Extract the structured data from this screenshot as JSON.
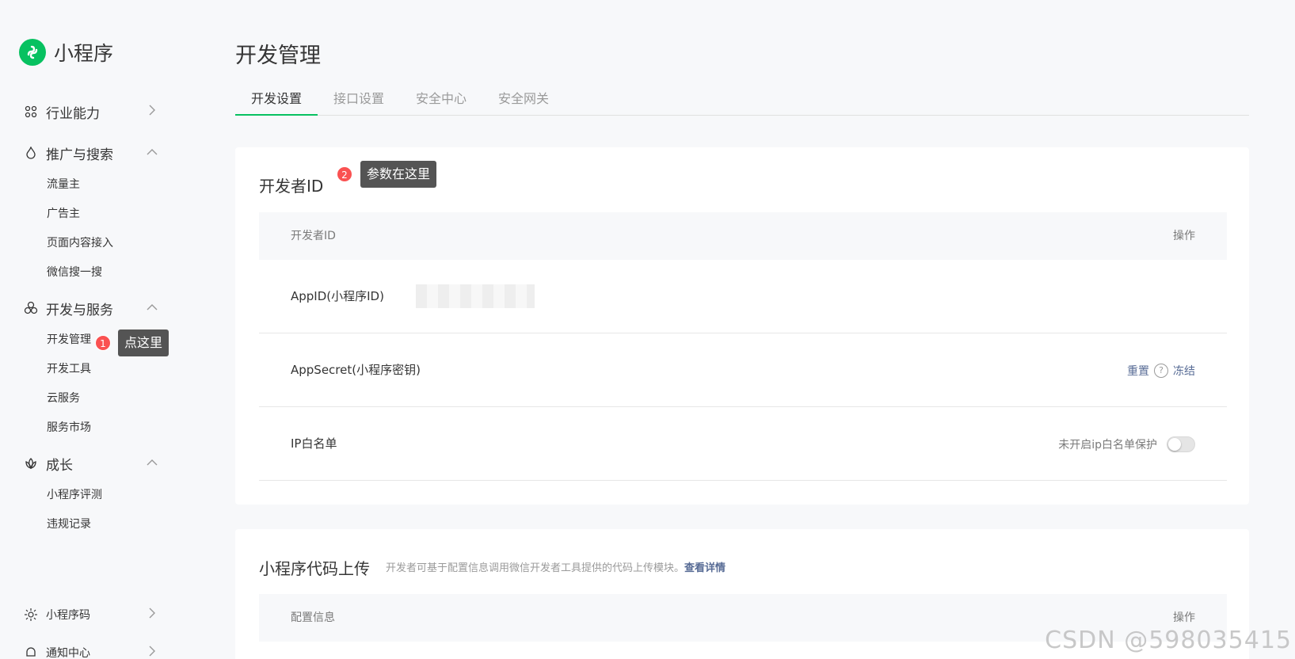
{
  "brand": {
    "title": "小程序",
    "logo_color": "#07c160"
  },
  "sidebar": {
    "groups": [
      {
        "label": "行业能力",
        "icon": "cluster-icon",
        "arrow": "›"
      },
      {
        "label": "推广与搜索",
        "icon": "flame-icon",
        "arrow": "ˆ",
        "items": [
          "流量主",
          "广告主",
          "页面内容接入",
          "微信搜一搜"
        ]
      },
      {
        "label": "开发与服务",
        "icon": "circles-icon",
        "arrow": "ˆ",
        "items": [
          "开发管理",
          "开发工具",
          "云服务",
          "服务市场"
        ]
      },
      {
        "label": "成长",
        "icon": "lotus-icon",
        "arrow": "ˆ",
        "items": [
          "小程序评测",
          "违规记录"
        ]
      },
      {
        "label": "小程序码",
        "icon": "sun-icon",
        "arrow": "›"
      },
      {
        "label": "通知中心",
        "icon": "bell-icon",
        "arrow": "›"
      }
    ]
  },
  "annotations": {
    "one": {
      "badge": "1",
      "text": "点这里"
    },
    "two": {
      "badge": "2",
      "text": "参数在这里"
    }
  },
  "main": {
    "title": "开发管理",
    "tabs": [
      "开发设置",
      "接口设置",
      "安全中心",
      "安全网关"
    ],
    "developer_id": {
      "title": "开发者ID",
      "columns": [
        "开发者ID",
        "操作"
      ],
      "rows": [
        {
          "label": "AppID(小程序ID)"
        },
        {
          "label": "AppSecret(小程序密钥)",
          "action_reset": "重置",
          "help": "?",
          "action_freeze": "冻结"
        },
        {
          "label": "IP白名单",
          "status": "未开启ip白名单保护"
        }
      ]
    },
    "upload": {
      "title": "小程序代码上传",
      "desc": "开发者可基于配置信息调用微信开发者工具提供的代码上传模块。",
      "desc_link": "查看详情",
      "columns": [
        "配置信息",
        "操作"
      ]
    }
  },
  "watermark": "CSDN @598035415",
  "colors": {
    "accent": "#07c160",
    "link": "#576b95",
    "badge": "#fa5151"
  }
}
